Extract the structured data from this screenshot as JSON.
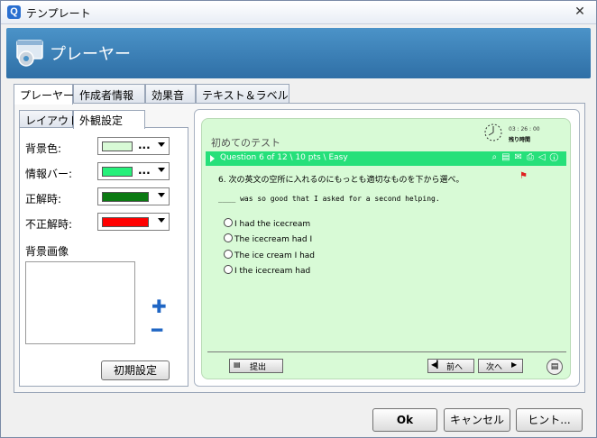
{
  "window": {
    "title": "テンプレート",
    "app_icon_letter": "Q"
  },
  "banner": {
    "title": "プレーヤー"
  },
  "tabs": [
    {
      "label": "プレーヤー"
    },
    {
      "label": "作成者情報"
    },
    {
      "label": "効果音"
    },
    {
      "label": "テキスト＆ラベル"
    }
  ],
  "subtabs": [
    {
      "label": "レイアウト"
    },
    {
      "label": "外観設定"
    }
  ],
  "appearance": {
    "rows": [
      {
        "label": "背景色:",
        "color": "#d8fad6"
      },
      {
        "label": "情報バー:",
        "color": "#26f07a"
      },
      {
        "label": "正解時:",
        "color": "#0b7a12"
      },
      {
        "label": "不正解時:",
        "color": "#ff0000"
      }
    ],
    "dots": "...",
    "bg_image_label": "背景画像",
    "reset_label": "初期設定"
  },
  "preview": {
    "test_title": "初めてのテスト",
    "time_label": "03 : 26 : 00",
    "time_sub": "残り時間",
    "question_bar": "Question 6 of 12 \\ 10 pts \\ Easy",
    "question": "6.  次の英文の空所に入れるのにもっとも適切なものを下から選べ。",
    "sentence": "____ was so good that I asked for a second helping.",
    "choices": [
      "I had the icecream",
      "The icecream had I",
      "The ice cream I had",
      "I the icecream had"
    ],
    "submit_label": "提出",
    "prev_label": "前へ",
    "next_label": "次へ"
  },
  "buttons": {
    "ok": "Ok",
    "cancel": "キャンセル",
    "hint": "ヒント..."
  }
}
